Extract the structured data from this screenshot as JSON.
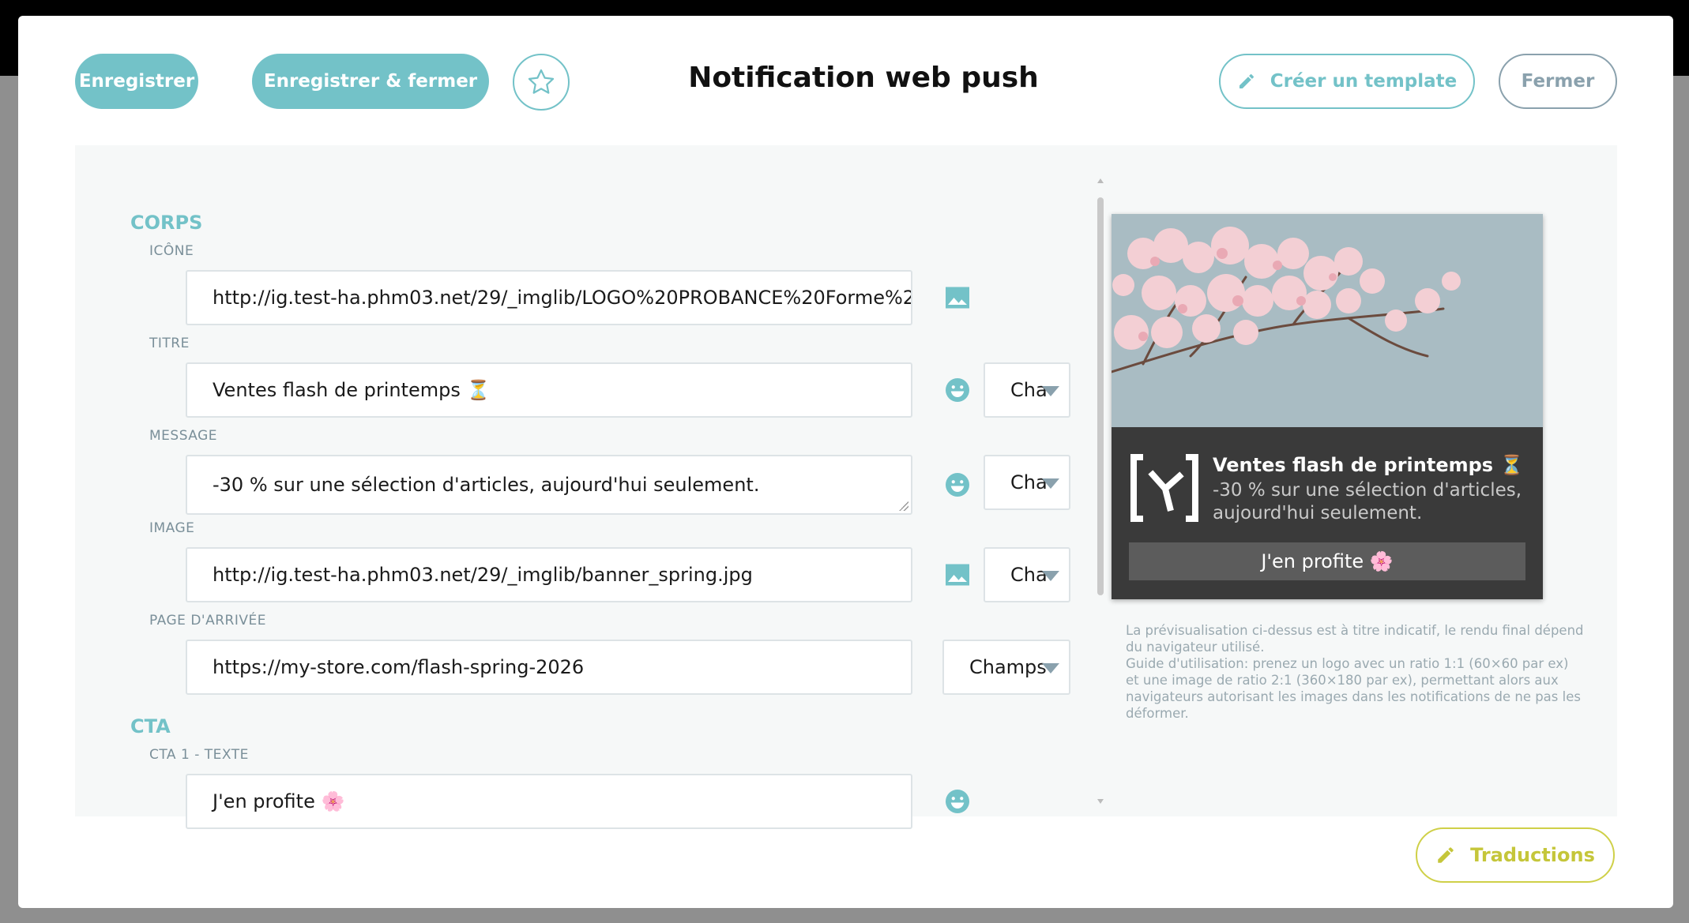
{
  "header": {
    "save_label": "Enregistrer",
    "save_close_label": "Enregistrer & fermer",
    "title": "Notification web push",
    "create_template_label": "Créer un template",
    "close_label": "Fermer"
  },
  "form": {
    "corps_title": "CORPS",
    "icone_label": "ICÔNE",
    "icone_value": "http://ig.test-ha.phm03.net/29/_imglib/LOGO%20PROBANCE%20Forme%2",
    "titre_label": "TITRE",
    "titre_value": "Ventes flash de printemps ⏳",
    "titre_select": "Cha",
    "message_label": "MESSAGE",
    "message_value": "-30 % sur une sélection d'articles, aujourd'hui seulement.",
    "message_select": "Cha",
    "image_label": "IMAGE",
    "image_value": "http://ig.test-ha.phm03.net/29/_imglib/banner_spring.jpg",
    "image_select": "Cha",
    "landing_label": "PAGE D'ARRIVÉE",
    "landing_value": "https://my-store.com/flash-spring-2026",
    "landing_select": "Champs",
    "cta_title": "CTA",
    "cta1_label": "CTA 1 - TEXTE",
    "cta1_value": "J'en profite 🌸"
  },
  "preview": {
    "title": "Ventes flash de printemps ⏳",
    "message": "-30 % sur une sélection d'articles, aujourd'hui seulement.",
    "cta": "J'en profite 🌸",
    "help_1": "La prévisualisation ci-dessus est à titre indicatif, le rendu final dépend du navigateur utilisé.",
    "help_2": "Guide d'utilisation: prenez un logo avec un ratio 1:1 (60×60 par ex) et une image de ratio 2:1 (360×180 par ex), permettant alors aux navigateurs autorisant les images dans les notifications de ne pas les déformer."
  },
  "footer": {
    "translations_label": "Traductions"
  },
  "colors": {
    "accent": "#73c2c8",
    "secondary": "#8aa1ad",
    "translations": "#c5c63a"
  },
  "icons": [
    "star-icon",
    "pencil-icon",
    "image-icon",
    "emoji-icon",
    "chevron-down-icon"
  ]
}
